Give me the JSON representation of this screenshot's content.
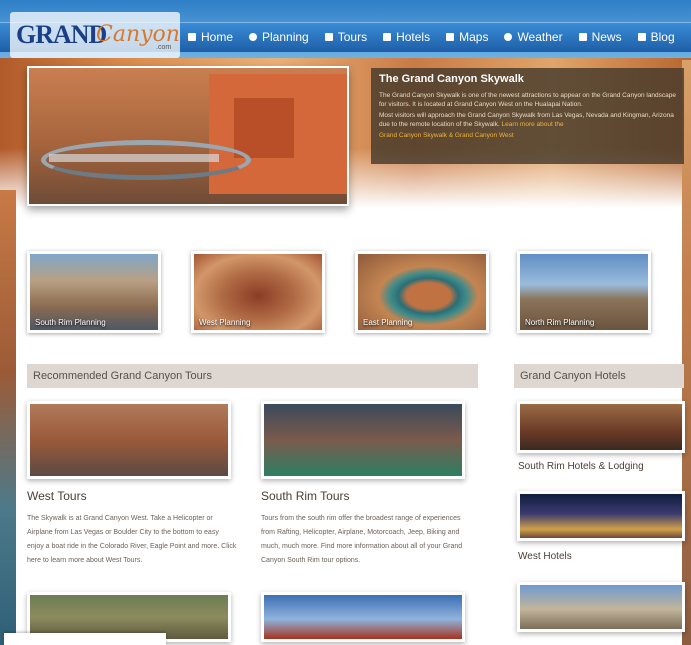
{
  "logo": {
    "word1": "GRAND",
    "word2": "Canyon",
    "suffix": ".com"
  },
  "nav": [
    {
      "label": "Home",
      "icon": "home-icon"
    },
    {
      "label": "Planning",
      "icon": "pin-icon"
    },
    {
      "label": "Tours",
      "icon": "plane-icon"
    },
    {
      "label": "Hotels",
      "icon": "bed-icon"
    },
    {
      "label": "Maps",
      "icon": "map-icon"
    },
    {
      "label": "Weather",
      "icon": "umbrella-icon"
    },
    {
      "label": "News",
      "icon": "newspaper-icon"
    },
    {
      "label": "Blog",
      "icon": "blog-icon"
    }
  ],
  "hero": {
    "title": "The Grand Canyon Skywalk",
    "p1": "The Grand Canyon Skywalk is one of the newest attractions to appear on the Grand Canyon landscape for visitors. It is located at Grand Canyon West on the Hualapai Nation.",
    "p2": "Most visitors will approach the Grand Canyon Skywalk from Las Vegas, Nevada and Kingman, Arizona due to the remote location of the Skywalk.",
    "more_link": "Learn more about the",
    "link": "Grand Canyon Skywalk & Grand Canyon West"
  },
  "planning": [
    {
      "label": "South Rim Planning"
    },
    {
      "label": "West Planning"
    },
    {
      "label": "East Planning"
    },
    {
      "label": "North Rim Planning"
    }
  ],
  "sections": {
    "tours": "Recommended Grand Canyon Tours",
    "hotels": "Grand Canyon Hotels"
  },
  "tours": [
    {
      "title": "West Tours",
      "desc": "The Skywalk is at Grand Canyon West. Take a Helicopter or Airplane from Las Vegas or Boulder City to the bottom to easy enjoy a boat ride in the Colorado River, Eagle Point and more. Click here to learn more about West Tours."
    },
    {
      "title": "South Rim Tours",
      "desc": "Tours from the south rim offer the broadest range of experiences from Rafting, Helicopter, Airplane, Motorcoach, Jeep, Biking and much, much more. Find more information about all of your Grand Canyon South Rim tour options."
    }
  ],
  "hotels": [
    {
      "label": "South Rim Hotels & Lodging"
    },
    {
      "label": "West Hotels"
    },
    {
      "label": ""
    }
  ],
  "colors": {
    "nav_bar": "#1d5fa7",
    "section_bar": "#ddd6d1",
    "hero_panel": "#463a2c",
    "link": "#f0b33a"
  }
}
